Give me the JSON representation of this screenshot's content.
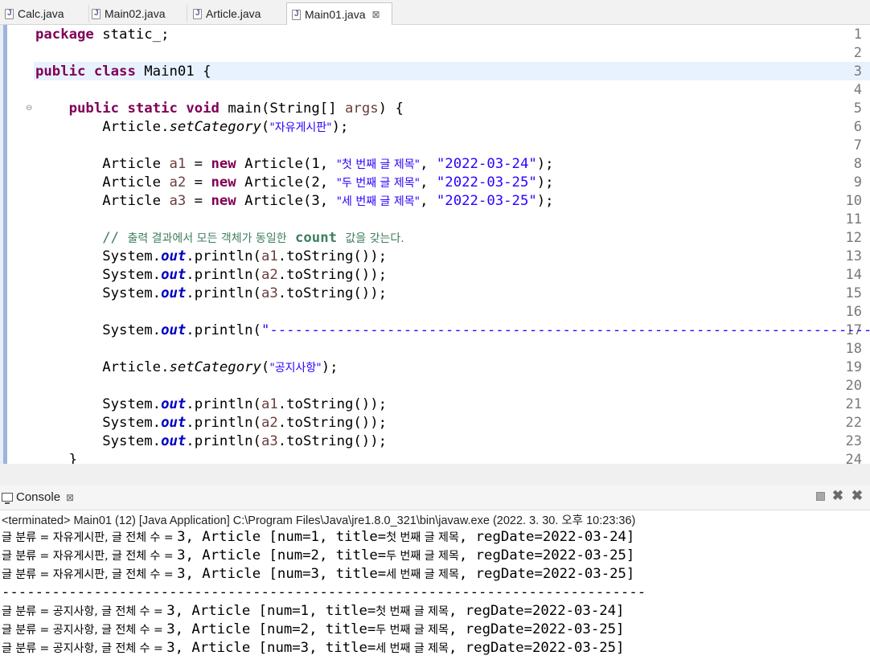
{
  "tabs": [
    {
      "label": "Calc.java",
      "active": false
    },
    {
      "label": "Main02.java",
      "active": false
    },
    {
      "label": "Article.java",
      "active": false
    },
    {
      "label": "Main01.java",
      "active": true,
      "close": "⊠"
    }
  ],
  "editor": {
    "line_numbers": [
      "1",
      "2",
      "3",
      "4",
      "5",
      "6",
      "7",
      "8",
      "9",
      "10",
      "11",
      "12",
      "13",
      "14",
      "15",
      "16",
      "17",
      "18",
      "19",
      "20",
      "21",
      "22",
      "23",
      "24"
    ],
    "current_line": 3,
    "code": {
      "l1_kw": "package",
      "l1_rest": " static_;",
      "l3_kw1": "public",
      "l3_kw2": "class",
      "l3_rest": " Main01 {",
      "l5_kw1": "public",
      "l5_kw2": "static",
      "l5_kw3": "void",
      "l5_a": " main(String[] ",
      "l5_var": "args",
      "l5_b": ") {",
      "l6_a": "Article.",
      "l6_m": "setCategory",
      "l6_b": "(",
      "l6_s": "\"자유게시판\"",
      "l6_c": ");",
      "l8_a": "Article ",
      "l8_v": "a1",
      "l8_b": " = ",
      "l8_kw": "new",
      "l8_c": " Article(1, ",
      "l8_s1": "\"첫 번째 글 제목\"",
      "l8_d": ", ",
      "l8_s2": "\"2022-03-24\"",
      "l8_e": ");",
      "l9_a": "Article ",
      "l9_v": "a2",
      "l9_b": " = ",
      "l9_kw": "new",
      "l9_c": " Article(2, ",
      "l9_s1": "\"두 번째 글 제목\"",
      "l9_d": ", ",
      "l9_s2": "\"2022-03-25\"",
      "l9_e": ");",
      "l10_a": "Article ",
      "l10_v": "a3",
      "l10_b": " = ",
      "l10_kw": "new",
      "l10_c": " Article(3, ",
      "l10_s1": "\"세 번째 글 제목\"",
      "l10_d": ", ",
      "l10_s2": "\"2022-03-25\"",
      "l10_e": ");",
      "l12_a": "// ",
      "l12_ko1": "출력 결과에서 모든 객체가 동일한",
      "l12_b": " count ",
      "l12_ko2": "값을 갖는다.",
      "l13_a": "System.",
      "l13_f": "out",
      "l13_b": ".println(",
      "l13_v": "a1",
      "l13_c": ".toString());",
      "l14_a": "System.",
      "l14_f": "out",
      "l14_b": ".println(",
      "l14_v": "a2",
      "l14_c": ".toString());",
      "l15_a": "System.",
      "l15_f": "out",
      "l15_b": ".println(",
      "l15_v": "a3",
      "l15_c": ".toString());",
      "l17_a": "System.",
      "l17_f": "out",
      "l17_b": ".println(",
      "l17_s": "\"---------------------------------------------------------------------------",
      "l19_a": "Article.",
      "l19_m": "setCategory",
      "l19_b": "(",
      "l19_s": "\"공지사항\"",
      "l19_c": ");",
      "l21_a": "System.",
      "l21_f": "out",
      "l21_b": ".println(",
      "l21_v": "a1",
      "l21_c": ".toString());",
      "l22_a": "System.",
      "l22_f": "out",
      "l22_b": ".println(",
      "l22_v": "a2",
      "l22_c": ".toString());",
      "l23_a": "System.",
      "l23_f": "out",
      "l23_b": ".println(",
      "l23_v": "a3",
      "l23_c": ".toString());",
      "l24": "}"
    }
  },
  "console": {
    "tab_label": "Console",
    "tab_close": "⊠",
    "status": "<terminated> Main01 (12) [Java Application] C:\\Program Files\\Java\\jre1.8.0_321\\bin\\javaw.exe (2022. 3. 30. 오후 10:23:36)",
    "output": [
      {
        "ko": "글 분류 = 자유게시판, 글 전체 수 = ",
        "a": "3, Article [num=1, title=",
        "ko2": "첫 번째 글 제목",
        "b": ", regDate=2022-03-24]"
      },
      {
        "ko": "글 분류 = 자유게시판, 글 전체 수 = ",
        "a": "3, Article [num=2, title=",
        "ko2": "두 번째 글 제목",
        "b": ", regDate=2022-03-25]"
      },
      {
        "ko": "글 분류 = 자유게시판, 글 전체 수 = ",
        "a": "3, Article [num=3, title=",
        "ko2": "세 번째 글 제목",
        "b": ", regDate=2022-03-25]"
      },
      {
        "sep": "-----------------------------------------------------------------------------"
      },
      {
        "ko": "글 분류 = 공지사항, 글 전체 수 = ",
        "a": "3, Article [num=1, title=",
        "ko2": "첫 번째 글 제목",
        "b": ", regDate=2022-03-24]"
      },
      {
        "ko": "글 분류 = 공지사항, 글 전체 수 = ",
        "a": "3, Article [num=2, title=",
        "ko2": "두 번째 글 제목",
        "b": ", regDate=2022-03-25]"
      },
      {
        "ko": "글 분류 = 공지사항, 글 전체 수 = ",
        "a": "3, Article [num=3, title=",
        "ko2": "세 번째 글 제목",
        "b": ", regDate=2022-03-25]"
      }
    ]
  }
}
